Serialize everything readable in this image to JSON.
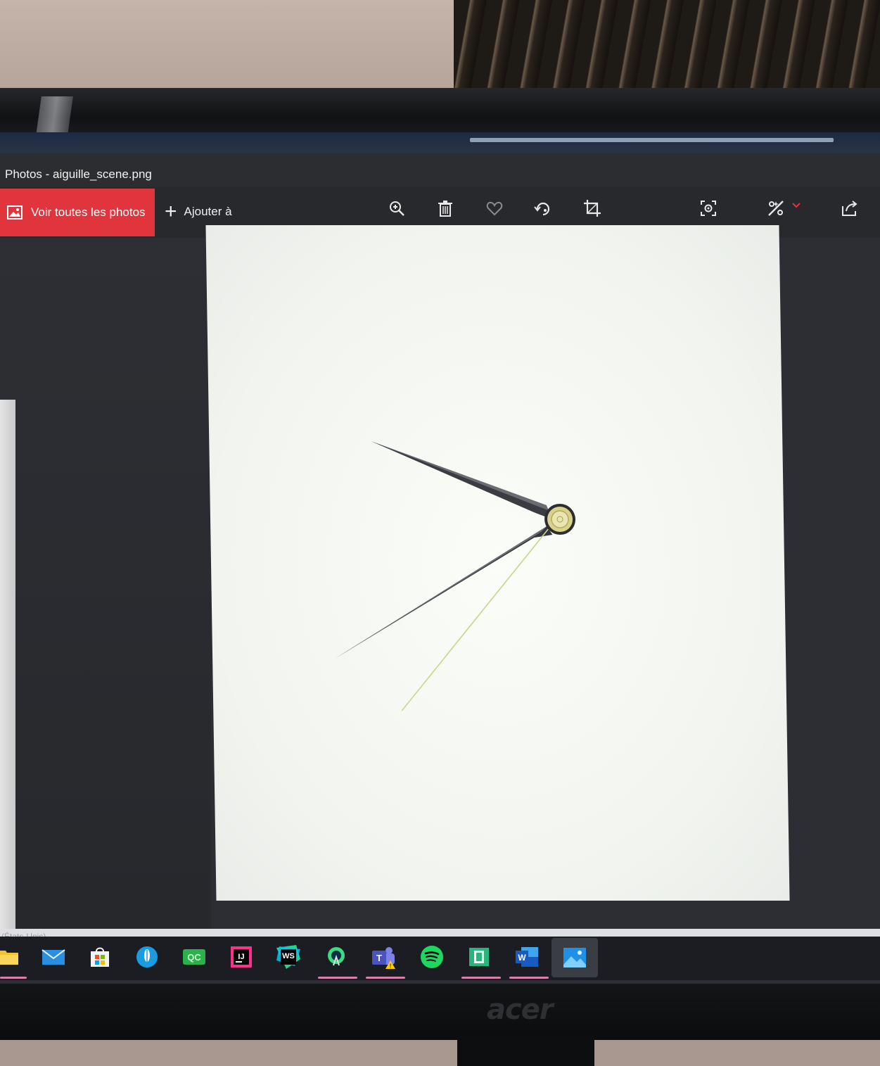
{
  "window": {
    "title": "Photos - aiguille_scene.png"
  },
  "toolbar": {
    "all_photos_label": "Voir toutes les photos",
    "add_to_label": "Ajouter à",
    "tools": [
      {
        "name": "zoom-icon"
      },
      {
        "name": "delete-icon"
      },
      {
        "name": "favorite-icon"
      },
      {
        "name": "rotate-icon"
      },
      {
        "name": "crop-icon"
      },
      {
        "name": "visual-search-icon"
      },
      {
        "name": "edit-icon"
      },
      {
        "name": "share-icon"
      }
    ]
  },
  "status": {
    "locale_text": "(États-Unis)"
  },
  "taskbar": {
    "apps": [
      {
        "name": "file-explorer-icon"
      },
      {
        "name": "mail-icon"
      },
      {
        "name": "store-icon"
      },
      {
        "name": "feather-app-icon"
      },
      {
        "name": "qc-app-icon",
        "label": "QC"
      },
      {
        "name": "intellij-icon",
        "label": "IJ"
      },
      {
        "name": "webstorm-icon",
        "label": "WS"
      },
      {
        "name": "android-studio-icon"
      },
      {
        "name": "teams-icon",
        "label": "T"
      },
      {
        "name": "spotify-icon"
      },
      {
        "name": "notes-app-icon"
      },
      {
        "name": "word-icon",
        "label": "W"
      },
      {
        "name": "photos-icon"
      }
    ]
  },
  "monitor": {
    "brand": "acer"
  },
  "colors": {
    "accent_red": "#e0353d",
    "toolbar_bg": "#27292d",
    "hand_dark": "#3a3c42",
    "hub_gold": "#d9d28a"
  }
}
